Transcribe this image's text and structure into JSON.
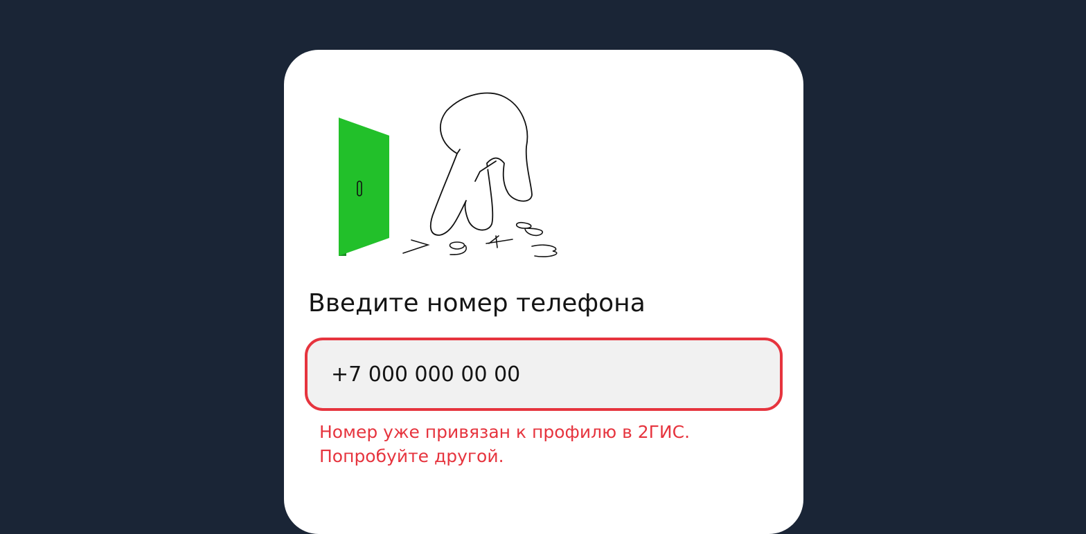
{
  "colors": {
    "background": "#1a2536",
    "card": "#ffffff",
    "accent_error": "#e6343e",
    "door_green": "#22c02a",
    "field_fill": "#f1f1f1"
  },
  "illustration": {
    "door_icon": "green-door-icon",
    "hand_icon": "hand-typing-icon",
    "digits": [
      "7",
      "9",
      "4",
      "8",
      "3"
    ]
  },
  "form": {
    "title": "Введите номер телефона",
    "phone_value": "+7 000 000 00 00",
    "error_line_1": "Номер уже привязан к профилю в 2ГИС.",
    "error_line_2": "Попробуйте другой."
  }
}
